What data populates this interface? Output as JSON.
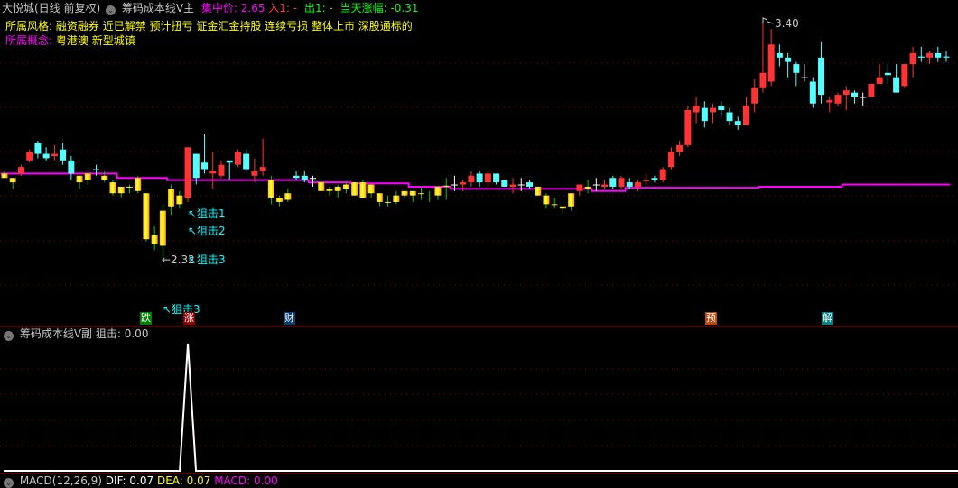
{
  "header": {
    "stock": "大悦城(日线 前复权)",
    "indicator": "筹码成本线V主",
    "focus_label": "集中价: 2.65",
    "entry_label": "入1: -",
    "exit_label": "出1: -",
    "change_label": "当天涨幅: -0.31"
  },
  "style_line": {
    "label": "所属风格:",
    "value": "融资融券 近已解禁 预计扭亏 证金汇金持股 连续亏损 整体上市 深股通标的"
  },
  "concept_line": {
    "label": "所属概念:",
    "value": "粤港澳 新型城镇"
  },
  "annotations": {
    "snipe1": "↖狙击1",
    "snipe2": "↖狙击2",
    "snipe3": "↖狙击3",
    "snipe3b": "↖狙击3",
    "low_label": "←2.32",
    "high_label": "3.40"
  },
  "markers": [
    {
      "text": "跌",
      "color": "#008000"
    },
    {
      "text": "涨",
      "color": "#8b0000"
    },
    {
      "text": "财",
      "color": "#0b3d6b"
    },
    {
      "text": "预",
      "color": "#b8460b"
    },
    {
      "text": "解",
      "color": "#008080"
    }
  ],
  "sub_pane": {
    "indicator": "筹码成本线V副",
    "value_label": "狙击: 0.00"
  },
  "macd_pane": {
    "name": "MACD(12,26,9)",
    "dif": "DIF: 0.07",
    "dea": "DEA: 0.07",
    "macd": "MACD: 0.00"
  },
  "colors": {
    "up": "#ff3333",
    "down": "#54ffff",
    "doji": "#ffffff",
    "cost": "#ff00ff",
    "grid": "#800000",
    "wick_low": "#00cc00"
  },
  "chart_data": {
    "type": "candlestick",
    "price_range": [
      2.32,
      3.4
    ],
    "ohlc": [
      [
        2.71,
        2.72,
        2.69,
        2.69
      ],
      [
        2.69,
        2.69,
        2.64,
        2.67
      ],
      [
        2.71,
        2.75,
        2.7,
        2.74
      ],
      [
        2.77,
        2.82,
        2.76,
        2.81
      ],
      [
        2.85,
        2.86,
        2.78,
        2.8
      ],
      [
        2.8,
        2.83,
        2.77,
        2.78
      ],
      [
        2.79,
        2.84,
        2.77,
        2.8
      ],
      [
        2.82,
        2.85,
        2.75,
        2.77
      ],
      [
        2.77,
        2.79,
        2.68,
        2.71
      ],
      [
        2.7,
        2.7,
        2.64,
        2.67
      ],
      [
        2.68,
        2.71,
        2.66,
        2.71
      ],
      [
        2.73,
        2.75,
        2.7,
        2.725
      ],
      [
        2.7,
        2.72,
        2.67,
        2.68
      ],
      [
        2.67,
        2.68,
        2.61,
        2.62
      ],
      [
        2.62,
        2.65,
        2.6,
        2.65
      ],
      [
        2.65,
        2.66,
        2.62,
        2.65
      ],
      [
        2.69,
        2.7,
        2.62,
        2.63
      ],
      [
        2.62,
        2.62,
        2.4,
        2.41
      ],
      [
        2.43,
        2.47,
        2.36,
        2.39
      ],
      [
        2.38,
        2.57,
        2.32,
        2.54
      ],
      [
        2.56,
        2.66,
        2.52,
        2.64
      ],
      [
        2.61,
        2.63,
        2.55,
        2.57
      ],
      [
        2.6,
        2.83,
        2.58,
        2.83
      ],
      [
        2.8,
        2.8,
        2.66,
        2.69
      ],
      [
        2.76,
        2.89,
        2.71,
        2.73
      ],
      [
        2.71,
        2.81,
        2.64,
        2.72
      ],
      [
        2.7,
        2.77,
        2.69,
        2.75
      ],
      [
        2.77,
        2.77,
        2.68,
        2.76
      ],
      [
        2.75,
        2.82,
        2.74,
        2.81
      ],
      [
        2.8,
        2.82,
        2.72,
        2.73
      ],
      [
        2.7,
        2.78,
        2.67,
        2.72
      ],
      [
        2.72,
        2.87,
        2.7,
        2.74
      ],
      [
        2.68,
        2.7,
        2.57,
        2.6
      ],
      [
        2.6,
        2.61,
        2.56,
        2.58
      ],
      [
        2.59,
        2.64,
        2.58,
        2.62
      ],
      [
        2.7,
        2.72,
        2.68,
        2.69
      ],
      [
        2.7,
        2.72,
        2.67,
        2.68
      ],
      [
        2.69,
        2.7,
        2.65,
        2.69
      ],
      [
        2.67,
        2.68,
        2.63,
        2.63
      ],
      [
        2.64,
        2.65,
        2.61,
        2.63
      ],
      [
        2.63,
        2.66,
        2.6,
        2.65
      ],
      [
        2.66,
        2.67,
        2.62,
        2.64
      ],
      [
        2.67,
        2.67,
        2.61,
        2.61
      ],
      [
        2.67,
        2.68,
        2.6,
        2.6
      ],
      [
        2.66,
        2.66,
        2.6,
        2.62
      ],
      [
        2.62,
        2.62,
        2.56,
        2.58
      ],
      [
        2.58,
        2.61,
        2.56,
        2.58
      ],
      [
        2.61,
        2.63,
        2.57,
        2.58
      ],
      [
        2.63,
        2.63,
        2.6,
        2.61
      ],
      [
        2.61,
        2.63,
        2.58,
        2.63
      ],
      [
        2.62,
        2.65,
        2.59,
        2.62
      ],
      [
        2.6,
        2.63,
        2.58,
        2.6
      ],
      [
        2.61,
        2.65,
        2.59,
        2.65
      ],
      [
        2.65,
        2.69,
        2.59,
        2.655
      ],
      [
        2.66,
        2.7,
        2.63,
        2.66
      ],
      [
        2.66,
        2.68,
        2.63,
        2.67
      ],
      [
        2.67,
        2.72,
        2.65,
        2.7
      ],
      [
        2.71,
        2.72,
        2.65,
        2.67
      ],
      [
        2.67,
        2.72,
        2.65,
        2.71
      ],
      [
        2.71,
        2.71,
        2.66,
        2.67
      ],
      [
        2.68,
        2.68,
        2.65,
        2.65
      ],
      [
        2.65,
        2.69,
        2.62,
        2.66
      ],
      [
        2.66,
        2.69,
        2.63,
        2.66
      ],
      [
        2.67,
        2.68,
        2.64,
        2.65
      ],
      [
        2.65,
        2.65,
        2.61,
        2.61
      ],
      [
        2.61,
        2.62,
        2.55,
        2.57
      ],
      [
        2.57,
        2.6,
        2.55,
        2.57
      ],
      [
        2.56,
        2.56,
        2.53,
        2.55
      ],
      [
        2.56,
        2.62,
        2.54,
        2.62
      ],
      [
        2.63,
        2.66,
        2.61,
        2.66
      ],
      [
        2.65,
        2.68,
        2.62,
        2.64
      ],
      [
        2.66,
        2.69,
        2.63,
        2.66
      ],
      [
        2.65,
        2.68,
        2.64,
        2.66
      ],
      [
        2.69,
        2.7,
        2.64,
        2.65
      ],
      [
        2.65,
        2.7,
        2.64,
        2.69
      ],
      [
        2.67,
        2.69,
        2.64,
        2.65
      ],
      [
        2.65,
        2.68,
        2.63,
        2.67
      ],
      [
        2.675,
        2.71,
        2.66,
        2.68
      ],
      [
        2.69,
        2.7,
        2.67,
        2.68
      ],
      [
        2.68,
        2.74,
        2.67,
        2.73
      ],
      [
        2.74,
        2.83,
        2.73,
        2.81
      ],
      [
        2.81,
        2.86,
        2.79,
        2.84
      ],
      [
        2.84,
        3.02,
        2.83,
        3.0
      ],
      [
        2.99,
        3.06,
        2.94,
        3.02
      ],
      [
        3.01,
        3.04,
        2.92,
        2.95
      ],
      [
        2.99,
        3.03,
        2.94,
        3.01
      ],
      [
        3.02,
        3.04,
        2.97,
        3.0
      ],
      [
        2.99,
        3.01,
        2.93,
        2.95
      ],
      [
        2.95,
        2.97,
        2.91,
        2.93
      ],
      [
        2.93,
        3.06,
        2.93,
        3.02
      ],
      [
        3.03,
        3.14,
        2.99,
        3.1
      ],
      [
        3.1,
        3.4,
        3.08,
        3.17
      ],
      [
        3.13,
        3.37,
        3.11,
        3.3
      ],
      [
        3.26,
        3.3,
        3.2,
        3.24
      ],
      [
        3.24,
        3.26,
        3.15,
        3.22
      ],
      [
        3.21,
        3.22,
        3.11,
        3.17
      ],
      [
        3.15,
        3.21,
        3.13,
        3.15
      ],
      [
        3.13,
        3.15,
        3.01,
        3.03
      ],
      [
        3.24,
        3.31,
        3.03,
        3.07
      ],
      [
        3.035,
        3.06,
        2.99,
        3.045
      ],
      [
        3.03,
        3.08,
        3.02,
        3.07
      ],
      [
        3.07,
        3.11,
        3.0,
        3.09
      ],
      [
        3.08,
        3.09,
        3.03,
        3.06
      ],
      [
        3.06,
        3.08,
        3.02,
        3.06
      ],
      [
        3.06,
        3.12,
        3.06,
        3.12
      ],
      [
        3.12,
        3.21,
        3.12,
        3.15
      ],
      [
        3.17,
        3.21,
        3.12,
        3.16
      ],
      [
        3.15,
        3.21,
        3.08,
        3.08
      ],
      [
        3.11,
        3.21,
        3.1,
        3.21
      ],
      [
        3.21,
        3.29,
        3.15,
        3.26
      ],
      [
        3.245,
        3.29,
        3.22,
        3.24
      ],
      [
        3.24,
        3.27,
        3.21,
        3.26
      ],
      [
        3.26,
        3.29,
        3.22,
        3.24
      ],
      [
        3.245,
        3.27,
        3.22,
        3.24
      ]
    ],
    "cost_line": [
      [
        0,
        2.71
      ],
      [
        14,
        2.69
      ],
      [
        20,
        2.68
      ],
      [
        37,
        2.67
      ],
      [
        42,
        2.665
      ],
      [
        49,
        2.65
      ],
      [
        54,
        2.64
      ],
      [
        71,
        2.63
      ],
      [
        75,
        2.645
      ],
      [
        91,
        2.65
      ],
      [
        101,
        2.66
      ]
    ],
    "sub_signal": {
      "peak_index": 22,
      "peak_value": 1,
      "base_value": 0
    }
  }
}
